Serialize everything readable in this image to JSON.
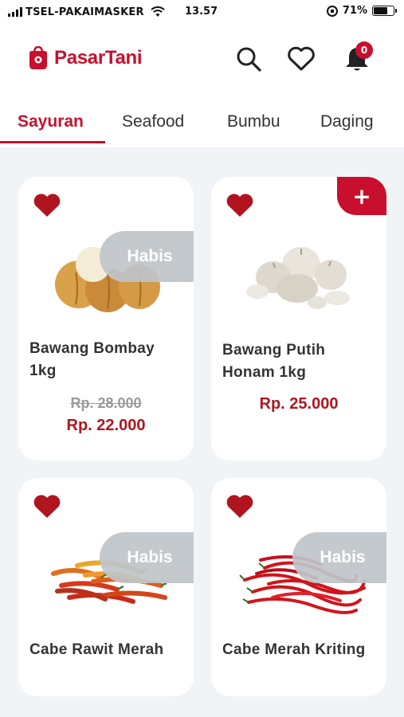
{
  "status_bar": {
    "carrier": "TSEL-PAKAIMASKER",
    "time": "13.57",
    "battery": "71%",
    "battery_level": 0.71
  },
  "header": {
    "logo_text": "PasarTani",
    "notification_count": "0",
    "brand_color": "#c8102e"
  },
  "tabs": [
    {
      "label": "Sayuran",
      "active": true
    },
    {
      "label": "Seafood",
      "active": false
    },
    {
      "label": "Bumbu",
      "active": false
    },
    {
      "label": "Daging",
      "active": false
    }
  ],
  "products": [
    {
      "name": "Bawang Bombay 1kg",
      "stock_label": "Habis",
      "old_price": "Rp. 28.000",
      "price": "Rp. 22.000",
      "favorite": true
    },
    {
      "name": "Bawang Putih Honam 1kg",
      "add_label": "+",
      "price": "Rp. 25.000",
      "favorite": true
    },
    {
      "name": "Cabe Rawit Merah",
      "stock_label": "Habis",
      "favorite": true
    },
    {
      "name": "Cabe Merah Kriting",
      "stock_label": "Habis",
      "favorite": true
    }
  ]
}
